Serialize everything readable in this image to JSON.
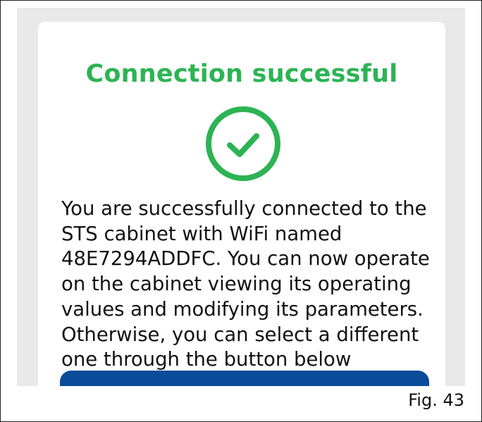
{
  "dialog": {
    "title": "Connection successful",
    "status_icon": "check-circle-icon",
    "message": "You are successfully connected to the STS cabinet with WiFi named 48E7294ADDFC. You can now operate on the cabinet viewing its operating values and modifying its parameters. Otherwise, you can select a different one through the button below",
    "primary_button_label": ""
  },
  "figure": {
    "caption": "Fig. 43"
  },
  "colors": {
    "success_green": "#2db354",
    "button_blue": "#0a4b9a",
    "screen_background": "#e9e9e9",
    "card_background": "#ffffff"
  }
}
